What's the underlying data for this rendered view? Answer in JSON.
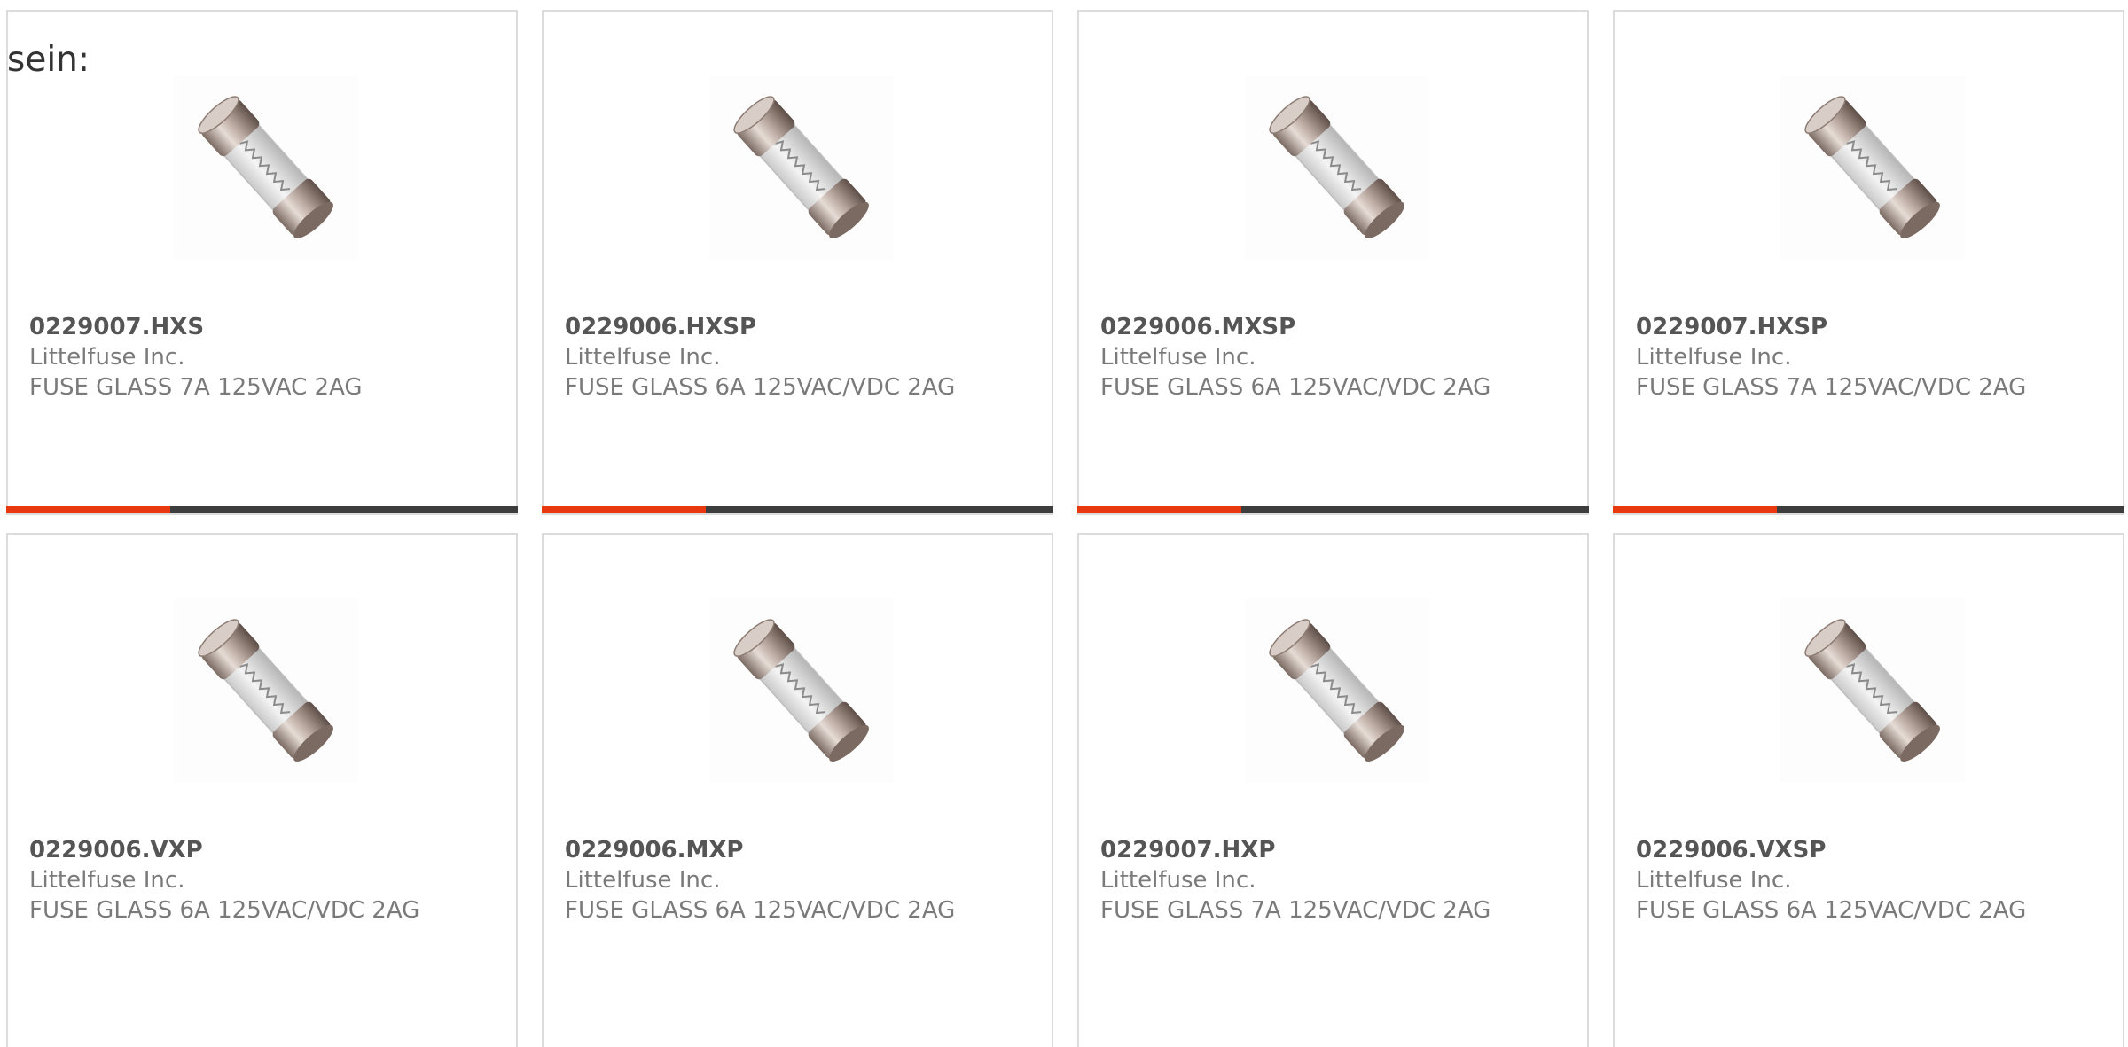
{
  "intro_text": "sein:",
  "colors": {
    "border": "#dcdcdc",
    "bar_track": "#3d3d3d",
    "bar_fill": "#e8380d",
    "part_number": "#555555",
    "meta_text": "#7a7a7a"
  },
  "product_image_icon": "glass-cartridge-fuse-icon",
  "products": [
    {
      "part_number": "0229007.HXS",
      "manufacturer": "Littelfuse Inc.",
      "description": "FUSE GLASS 7A 125VAC 2AG",
      "bar_fill_fraction": 0.32
    },
    {
      "part_number": "0229006.HXSP",
      "manufacturer": "Littelfuse Inc.",
      "description": "FUSE GLASS 6A 125VAC/VDC 2AG",
      "bar_fill_fraction": 0.32
    },
    {
      "part_number": "0229006.MXSP",
      "manufacturer": "Littelfuse Inc.",
      "description": "FUSE GLASS 6A 125VAC/VDC 2AG",
      "bar_fill_fraction": 0.32
    },
    {
      "part_number": "0229007.HXSP",
      "manufacturer": "Littelfuse Inc.",
      "description": "FUSE GLASS 7A 125VAC/VDC 2AG",
      "bar_fill_fraction": 0.32
    },
    {
      "part_number": "0229006.VXP",
      "manufacturer": "Littelfuse Inc.",
      "description": "FUSE GLASS 6A 125VAC/VDC 2AG"
    },
    {
      "part_number": "0229006.MXP",
      "manufacturer": "Littelfuse Inc.",
      "description": "FUSE GLASS 6A 125VAC/VDC 2AG"
    },
    {
      "part_number": "0229007.HXP",
      "manufacturer": "Littelfuse Inc.",
      "description": "FUSE GLASS 7A 125VAC/VDC 2AG"
    },
    {
      "part_number": "0229006.VXSP",
      "manufacturer": "Littelfuse Inc.",
      "description": "FUSE GLASS 6A 125VAC/VDC 2AG"
    }
  ]
}
